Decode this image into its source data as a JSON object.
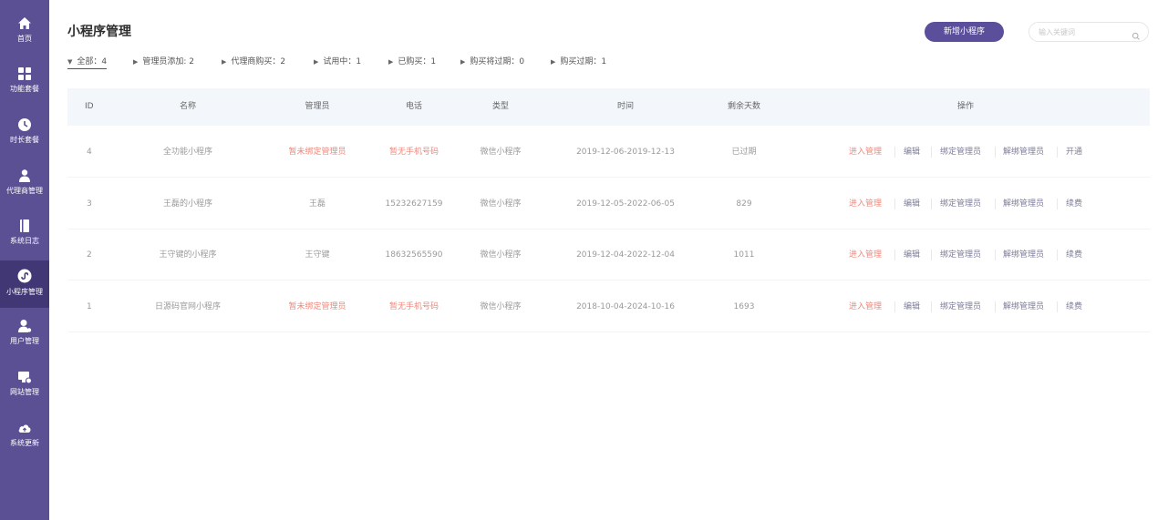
{
  "sidebar": {
    "items": [
      {
        "label": "首页",
        "icon": "home-icon"
      },
      {
        "label": "功能套餐",
        "icon": "grid-icon"
      },
      {
        "label": "时长套餐",
        "icon": "clock-icon"
      },
      {
        "label": "代理商管理",
        "icon": "agent-icon"
      },
      {
        "label": "系统日志",
        "icon": "log-icon"
      },
      {
        "label": "小程序管理",
        "icon": "miniprogram-icon",
        "active": true
      },
      {
        "label": "用户管理",
        "icon": "user-icon"
      },
      {
        "label": "网站管理",
        "icon": "website-icon"
      },
      {
        "label": "系统更新",
        "icon": "cloud-update-icon"
      }
    ]
  },
  "header": {
    "title": "小程序管理",
    "add_button": "新增小程序",
    "search_placeholder": "输入关键词"
  },
  "filters": [
    {
      "label": "全部：4",
      "active": true
    },
    {
      "label": "管理员添加: 2"
    },
    {
      "label": "代理商购买：2"
    },
    {
      "label": "试用中：1"
    },
    {
      "label": "已购买：1"
    },
    {
      "label": "购买将过期：0"
    },
    {
      "label": "购买过期：1"
    }
  ],
  "table": {
    "columns": [
      "ID",
      "名称",
      "管理员",
      "电话",
      "类型",
      "时间",
      "剩余天数",
      "操作"
    ],
    "rows": [
      {
        "id": "4",
        "name": "全功能小程序",
        "admin": "暂未绑定管理员",
        "phone": "暂无手机号码",
        "type": "微信小程序",
        "time": "2019-12-06-2019-12-13",
        "days": "已过期",
        "last_op": "开通"
      },
      {
        "id": "3",
        "name": "王磊的小程序",
        "admin": "王磊",
        "phone": "15232627159",
        "type": "微信小程序",
        "time": "2019-12-05-2022-06-05",
        "days": "829",
        "last_op": "续费"
      },
      {
        "id": "2",
        "name": "王守键的小程序",
        "admin": "王守键",
        "phone": "18632565590",
        "type": "微信小程序",
        "time": "2019-12-04-2022-12-04",
        "days": "1011",
        "last_op": "续费"
      },
      {
        "id": "1",
        "name": "日源码官网小程序",
        "admin": "暂未绑定管理员",
        "phone": "暂无手机号码",
        "type": "微信小程序",
        "time": "2018-10-04-2024-10-16",
        "days": "1693",
        "last_op": "续费"
      }
    ],
    "operations": [
      "进入管理",
      "编辑",
      "绑定管理员",
      "解绑管理员"
    ]
  },
  "colors": {
    "sidebar": "#5a5093",
    "sidebar_active": "#403774",
    "accent": "#5b4e9a",
    "warning_text": "#f0877a",
    "header_bg": "#f3f7fc"
  }
}
